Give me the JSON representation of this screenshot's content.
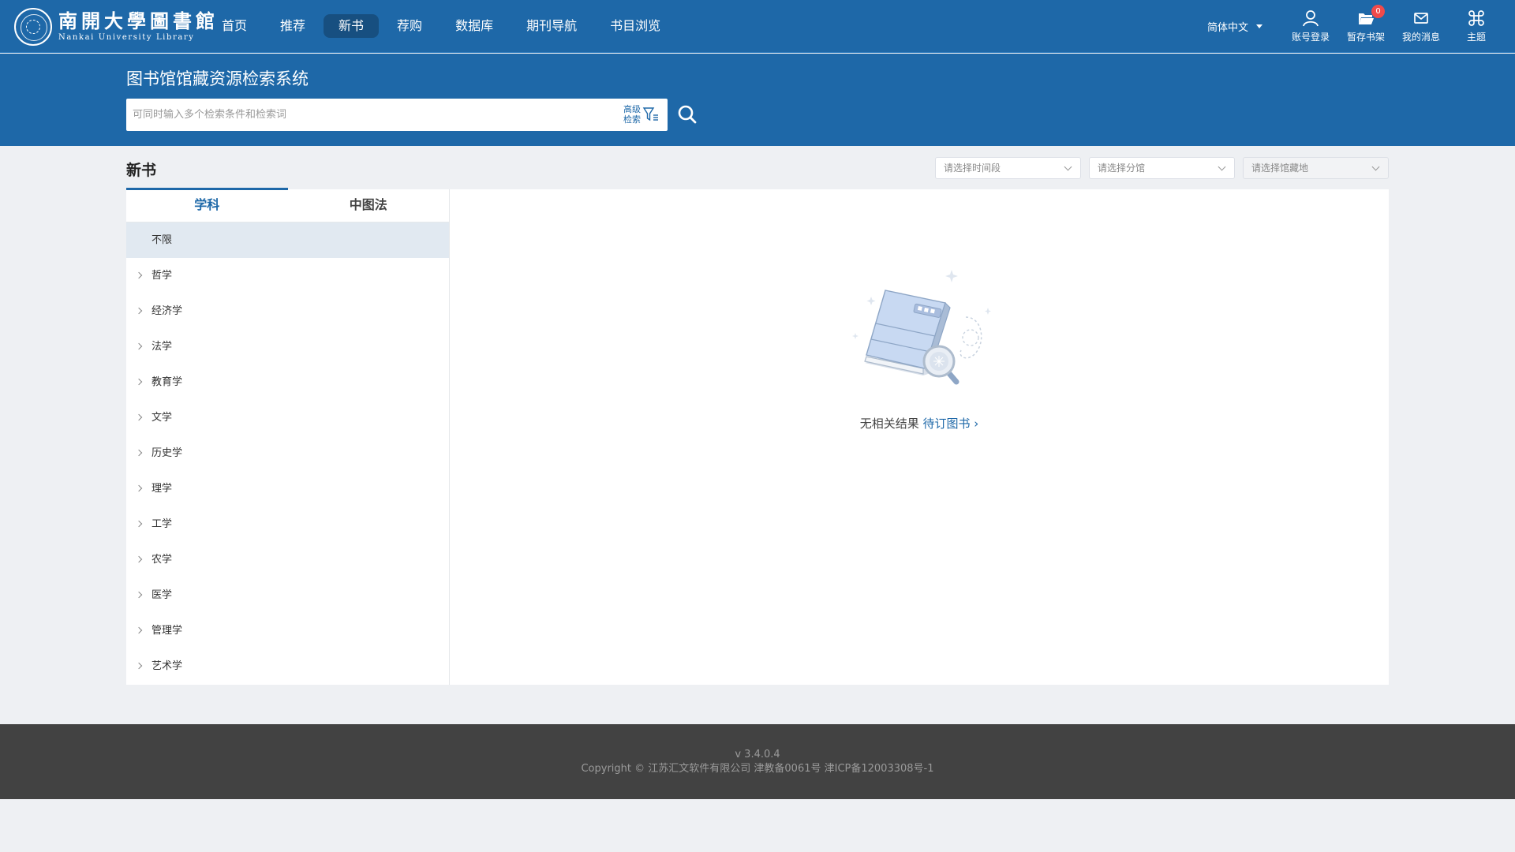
{
  "brand": {
    "name_cn": "南開大學圖書館",
    "name_en": "Nankai University Library"
  },
  "nav": {
    "items": [
      {
        "label": "首页"
      },
      {
        "label": "推荐"
      },
      {
        "label": "新书",
        "active": true
      },
      {
        "label": "荐购"
      },
      {
        "label": "数据库"
      },
      {
        "label": "期刊导航"
      },
      {
        "label": "书目浏览"
      }
    ],
    "language": "简体中文",
    "tools": [
      {
        "label": "账号登录",
        "icon": "user-icon"
      },
      {
        "label": "暂存书架",
        "icon": "folder-icon",
        "badge": "0"
      },
      {
        "label": "我的消息",
        "icon": "mail-icon"
      },
      {
        "label": "主题",
        "icon": "command-icon"
      }
    ]
  },
  "search": {
    "title": "图书馆馆藏资源检索系统",
    "placeholder": "可同时输入多个检索条件和检索词",
    "advanced_label": "高级检索"
  },
  "main": {
    "section_title": "新书",
    "filters": [
      {
        "placeholder": "请选择时间段"
      },
      {
        "placeholder": "请选择分馆"
      },
      {
        "placeholder": "请选择馆藏地"
      }
    ],
    "tabs": [
      {
        "label": "学科",
        "active": true
      },
      {
        "label": "中图法"
      }
    ],
    "categories": [
      {
        "label": "不限",
        "selected": true
      },
      {
        "label": "哲学"
      },
      {
        "label": "经济学"
      },
      {
        "label": "法学"
      },
      {
        "label": "教育学"
      },
      {
        "label": "文学"
      },
      {
        "label": "历史学"
      },
      {
        "label": "理学"
      },
      {
        "label": "工学"
      },
      {
        "label": "农学"
      },
      {
        "label": "医学"
      },
      {
        "label": "管理学"
      },
      {
        "label": "艺术学"
      }
    ],
    "empty": {
      "text": "无相关结果",
      "link": "待订图书",
      "link_arrow": "›"
    }
  },
  "footer": {
    "version": "v 3.4.0.4",
    "copyright": "Copyright © 江苏汇文软件有限公司 津教备0061号 津ICP备12003308号-1"
  },
  "colors": {
    "primary": "#1e68a8",
    "nav_active": "#174f80",
    "footer_bg": "#424242",
    "badge": "#f04a4a"
  }
}
